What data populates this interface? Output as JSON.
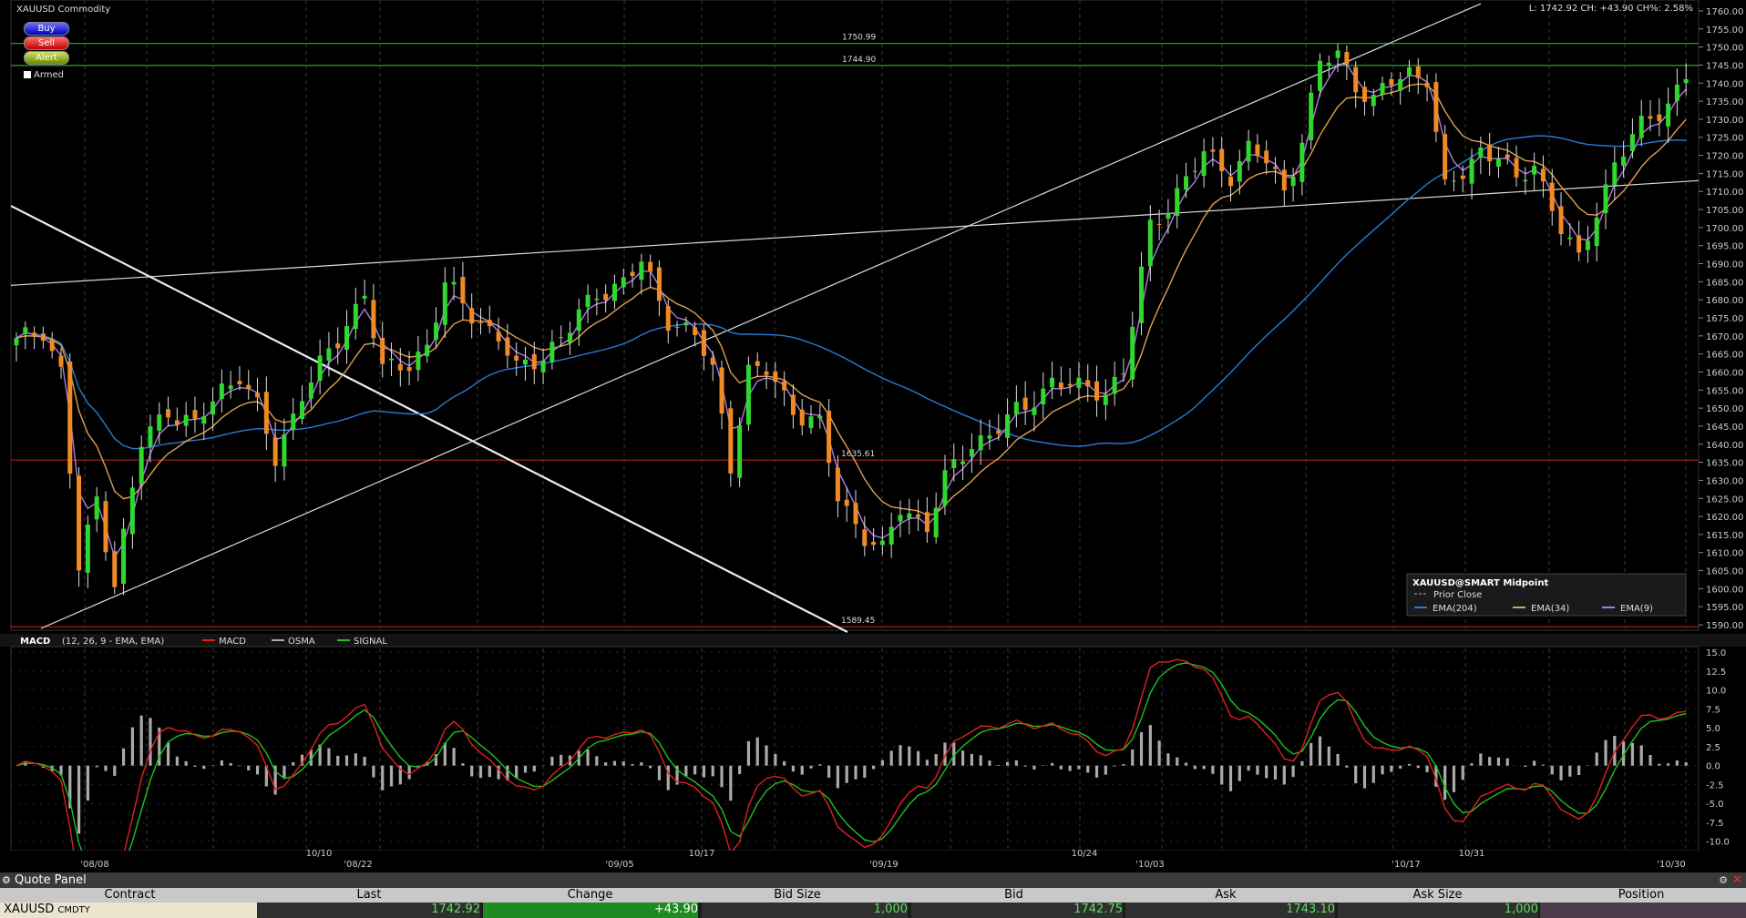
{
  "header": {
    "title": "XAUUSD Commodity",
    "summary": "L: 1742.92 CH: +43.90 CH%: 2.58%",
    "buttons": [
      "Buy",
      "Sell",
      "Alert"
    ],
    "armed_label": "Armed"
  },
  "legend": {
    "title": "XAUUSD@SMART Midpoint",
    "prior_close": "Prior Close",
    "items": [
      {
        "label": "EMA(204)",
        "color": "#2a7bd4"
      },
      {
        "label": "EMA(34)",
        "color": "#e0a050"
      },
      {
        "label": "EMA(9)",
        "color": "#b07ae0"
      }
    ]
  },
  "macd_header": {
    "label": "MACD",
    "params": "(12, 26, 9 - EMA, EMA)",
    "items": [
      {
        "label": "MACD",
        "color": "#e02020"
      },
      {
        "label": "OSMA",
        "color": "#aaaaaa"
      },
      {
        "label": "SIGNAL",
        "color": "#20c020"
      }
    ]
  },
  "quote_panel": {
    "title": "Quote Panel",
    "columns": [
      "Contract",
      "Last",
      "Change",
      "Bid Size",
      "Bid",
      "Ask",
      "Ask Size",
      "Position"
    ],
    "row": {
      "contract": "XAUUSD",
      "type": "CMDTY",
      "last": "1742.92",
      "change": "+43.90",
      "bid_size": "1,000",
      "bid": "1742.75",
      "ask": "1743.10",
      "ask_size": "1,000",
      "position": ""
    }
  },
  "chart_data": [
    {
      "type": "candlestick",
      "title": "XAUUSD Commodity",
      "ylim": [
        1589,
        1761
      ],
      "y_ticks": [
        1590,
        1595,
        1600,
        1605,
        1610,
        1615,
        1620,
        1625,
        1630,
        1635,
        1640,
        1645,
        1650,
        1655,
        1660,
        1665,
        1670,
        1675,
        1680,
        1685,
        1690,
        1695,
        1700,
        1705,
        1710,
        1715,
        1720,
        1725,
        1730,
        1735,
        1740,
        1745,
        1750,
        1755,
        1760
      ],
      "x_labels_bottom": [
        "'08/08",
        "'08/22",
        "'09/05",
        "'09/19",
        "'10/03",
        "'10/17",
        "'10/30"
      ],
      "x_labels_top": [
        "10/10",
        "10/17",
        "10/24",
        "10/31"
      ],
      "close_keyframes": [
        [
          0,
          1668
        ],
        [
          3,
          1672
        ],
        [
          5,
          1660
        ],
        [
          7,
          1605
        ],
        [
          9,
          1625
        ],
        [
          11,
          1602
        ],
        [
          14,
          1640
        ],
        [
          17,
          1650
        ],
        [
          20,
          1645
        ],
        [
          23,
          1655
        ],
        [
          25,
          1660
        ],
        [
          27,
          1650
        ],
        [
          29,
          1635
        ],
        [
          32,
          1655
        ],
        [
          36,
          1668
        ],
        [
          39,
          1683
        ],
        [
          41,
          1660
        ],
        [
          44,
          1662
        ],
        [
          46,
          1668
        ],
        [
          48,
          1684
        ],
        [
          51,
          1676
        ],
        [
          54,
          1670
        ],
        [
          56,
          1660
        ],
        [
          59,
          1665
        ],
        [
          62,
          1672
        ],
        [
          65,
          1682
        ],
        [
          68,
          1685
        ],
        [
          70,
          1690
        ],
        [
          73,
          1675
        ],
        [
          76,
          1670
        ],
        [
          78,
          1660
        ],
        [
          80,
          1635
        ],
        [
          82,
          1660
        ],
        [
          84,
          1660
        ],
        [
          87,
          1650
        ],
        [
          90,
          1645
        ],
        [
          92,
          1625
        ],
        [
          95,
          1615
        ],
        [
          97,
          1610
        ],
        [
          99,
          1622
        ],
        [
          102,
          1618
        ],
        [
          104,
          1630
        ],
        [
          107,
          1640
        ],
        [
          110,
          1645
        ],
        [
          113,
          1650
        ],
        [
          116,
          1658
        ],
        [
          119,
          1655
        ],
        [
          122,
          1655
        ],
        [
          124,
          1660
        ],
        [
          127,
          1700
        ],
        [
          130,
          1710
        ],
        [
          133,
          1720
        ],
        [
          136,
          1715
        ],
        [
          138,
          1722
        ],
        [
          140,
          1718
        ],
        [
          142,
          1710
        ],
        [
          144,
          1725
        ],
        [
          146,
          1745
        ],
        [
          148,
          1748
        ],
        [
          150,
          1740
        ],
        [
          152,
          1735
        ],
        [
          154,
          1740
        ],
        [
          156,
          1743
        ],
        [
          158,
          1742
        ],
        [
          160,
          1710
        ],
        [
          162,
          1715
        ],
        [
          164,
          1722
        ],
        [
          166,
          1720
        ],
        [
          168,
          1712
        ],
        [
          170,
          1718
        ],
        [
          173,
          1700
        ],
        [
          175,
          1690
        ],
        [
          177,
          1705
        ],
        [
          179,
          1718
        ],
        [
          181,
          1725
        ],
        [
          183,
          1730
        ],
        [
          185,
          1735
        ],
        [
          187,
          1742
        ]
      ],
      "candle_count": 188,
      "h_lines": [
        {
          "value": 1750.99,
          "label": "1750.99",
          "color": "#2ea82e"
        },
        {
          "value": 1744.9,
          "label": "1744.90",
          "color": "#2ea82e"
        },
        {
          "value": 1635.61,
          "label": "1635.61",
          "color": "#b02020"
        },
        {
          "value": 1589.45,
          "label": "1589.45",
          "color": "#b02020"
        }
      ]
    },
    {
      "type": "macd",
      "ylim": [
        -11,
        15.5
      ],
      "y_ticks": [
        -10.0,
        -7.5,
        -5.0,
        -2.5,
        0.0,
        2.5,
        5.0,
        7.5,
        10.0,
        12.5,
        15.0
      ],
      "series": [
        {
          "name": "MACD",
          "color": "#e02020"
        },
        {
          "name": "OSMA",
          "color": "#aaaaaa"
        },
        {
          "name": "SIGNAL",
          "color": "#20c020"
        }
      ]
    }
  ]
}
